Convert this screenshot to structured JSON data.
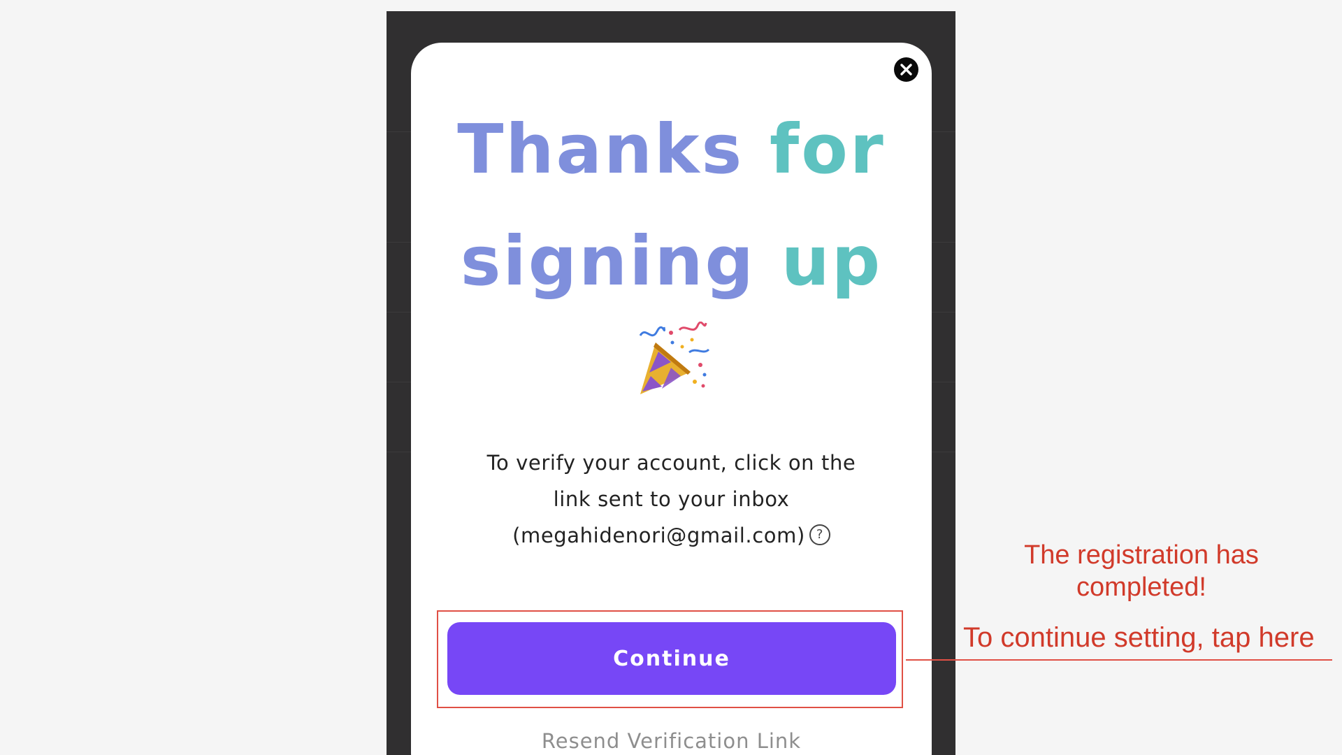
{
  "modal": {
    "title_line_1": {
      "word_1": "Thanks",
      "word_2": "for"
    },
    "title_line_2": {
      "word_1": "signing",
      "word_2": "up"
    },
    "verify_text": {
      "line_1": "To verify your account, click on the",
      "line_2": "link sent to your inbox",
      "line_3": "(megahidenori@gmail.com)"
    },
    "help_icon_glyph": "?",
    "continue_label": "Continue",
    "resend_label": "Resend Verification Link",
    "icons": {
      "close": "close-icon",
      "help": "help-icon",
      "party": "party-popper-icon"
    }
  },
  "annotations": {
    "note_line_1": "The registration has",
    "note_line_2": "completed!",
    "tap_hint": "To continue setting, tap here"
  },
  "colors": {
    "overlay": "#302f30",
    "page_bg": "#f5f5f5",
    "button": "#7747f6",
    "title_blue": "#7f8fdc",
    "title_teal": "#5ec2c0",
    "annotation_red": "#d13a2a"
  }
}
